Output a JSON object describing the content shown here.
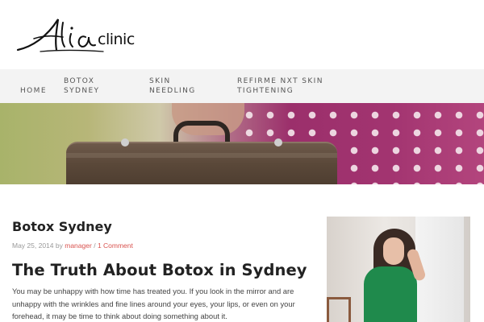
{
  "logo": {
    "script_text": "Alia",
    "suffix": "clinic"
  },
  "nav": {
    "items": [
      {
        "label": "HOME"
      },
      {
        "label": "BOTOX SYDNEY"
      },
      {
        "label": "SKIN NEEDLING"
      },
      {
        "label": "REFIRME NXT SKIN TIGHTENING"
      }
    ]
  },
  "post": {
    "title": "Botox Sydney",
    "date": "May 25, 2014",
    "by": "by",
    "author": "manager",
    "separator": "/",
    "comments": "1 Comment",
    "headline": "The Truth About Botox in Sydney",
    "body": "You may be unhappy with how time has treated you. If you look in the mirror and are unhappy with the wrinkles and fine lines around your eyes, your lips, or even on your forehead, it may be time to think about doing something about it."
  },
  "colors": {
    "nav_bg": "#f3f3f3",
    "link": "#d9534f",
    "hero_accent": "#a23470"
  }
}
